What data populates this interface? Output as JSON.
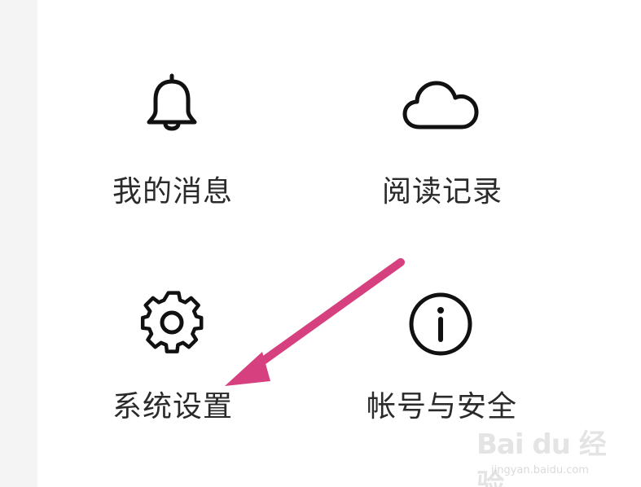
{
  "menu": {
    "items": [
      {
        "label": "我的消息",
        "icon": "bell-icon"
      },
      {
        "label": "阅读记录",
        "icon": "cloud-icon"
      },
      {
        "label": "系统设置",
        "icon": "gear-icon"
      },
      {
        "label": "帐号与安全",
        "icon": "info-icon"
      }
    ]
  },
  "annotation": {
    "arrow_color": "#d6407f",
    "points_to": "系统设置"
  },
  "watermark": {
    "logo_text": "Bai du 经验",
    "url": "jingyan.baidu.com"
  },
  "colors": {
    "text": "#2a2a2a",
    "icon_stroke": "#111111",
    "background": "#ffffff",
    "side_strip": "#f4f4f4"
  }
}
